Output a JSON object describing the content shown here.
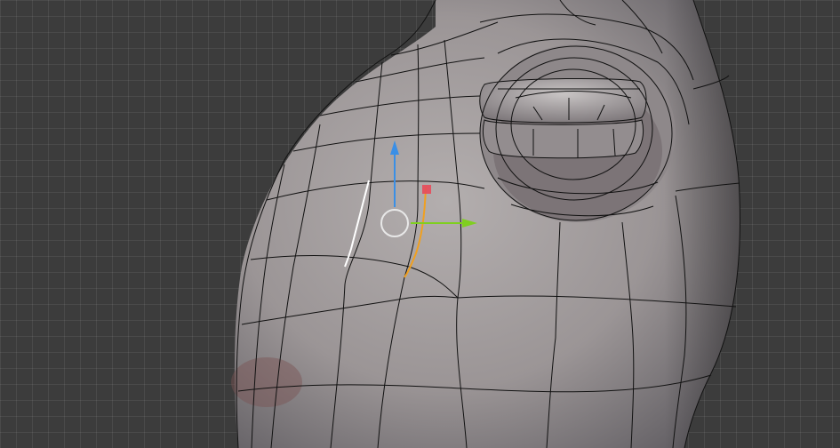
{
  "viewport": {
    "view": "3d-viewport-edit-mode",
    "background_color": "#3c3c3c",
    "grid_color": "#4a4a4a"
  },
  "mesh": {
    "object": "character-body-torso-with-nub",
    "shading": "solid",
    "base_color": "#9a9596",
    "wire_color": "#111111"
  },
  "selection": {
    "selected_edge_color": "#ffffff",
    "active_loop_color": "#f0a020"
  },
  "gizmo": {
    "type": "move-transform",
    "x_axis_color": "#7fcf1f",
    "y_axis_color": "#3a8fe6",
    "z_plane_color": "#e84a5a",
    "center_ring_color": "#e8e8e8"
  }
}
